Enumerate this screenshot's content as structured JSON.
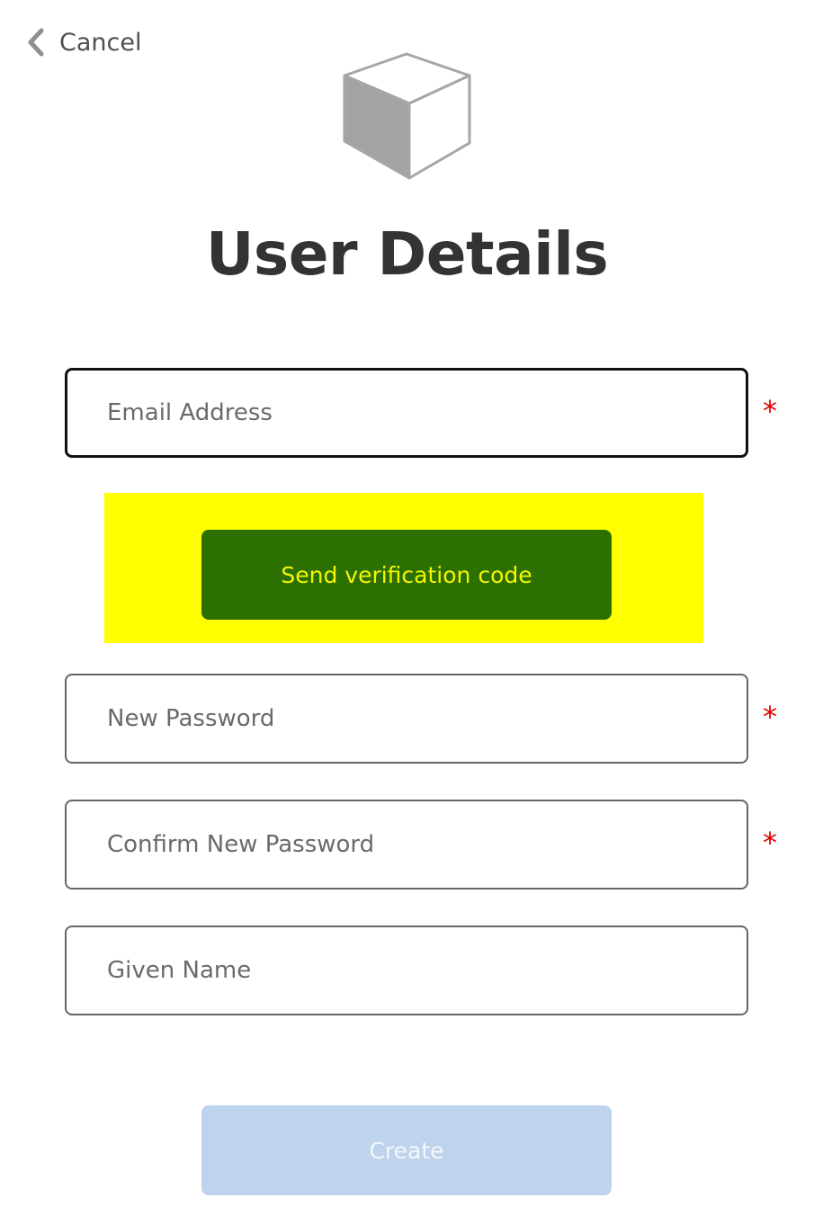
{
  "nav": {
    "cancel_label": "Cancel",
    "back_icon": "chevron-left-icon"
  },
  "logo": {
    "icon": "cube-icon"
  },
  "page": {
    "title": "User Details"
  },
  "form": {
    "email": {
      "placeholder": "Email Address",
      "value": "",
      "required_marker": "*"
    },
    "send_verification_label": "Send verification code",
    "new_password": {
      "placeholder": "New Password",
      "value": "",
      "required_marker": "*"
    },
    "confirm_password": {
      "placeholder": "Confirm New Password",
      "value": "",
      "required_marker": "*"
    },
    "given_name": {
      "placeholder": "Given Name",
      "value": ""
    },
    "create_label": "Create"
  },
  "colors": {
    "verify_panel_bg": "#ffff00",
    "send_button_bg": "#2b7000",
    "send_button_text": "#f5f500",
    "create_button_bg": "#bed3ec",
    "required_marker": "#e00000"
  }
}
